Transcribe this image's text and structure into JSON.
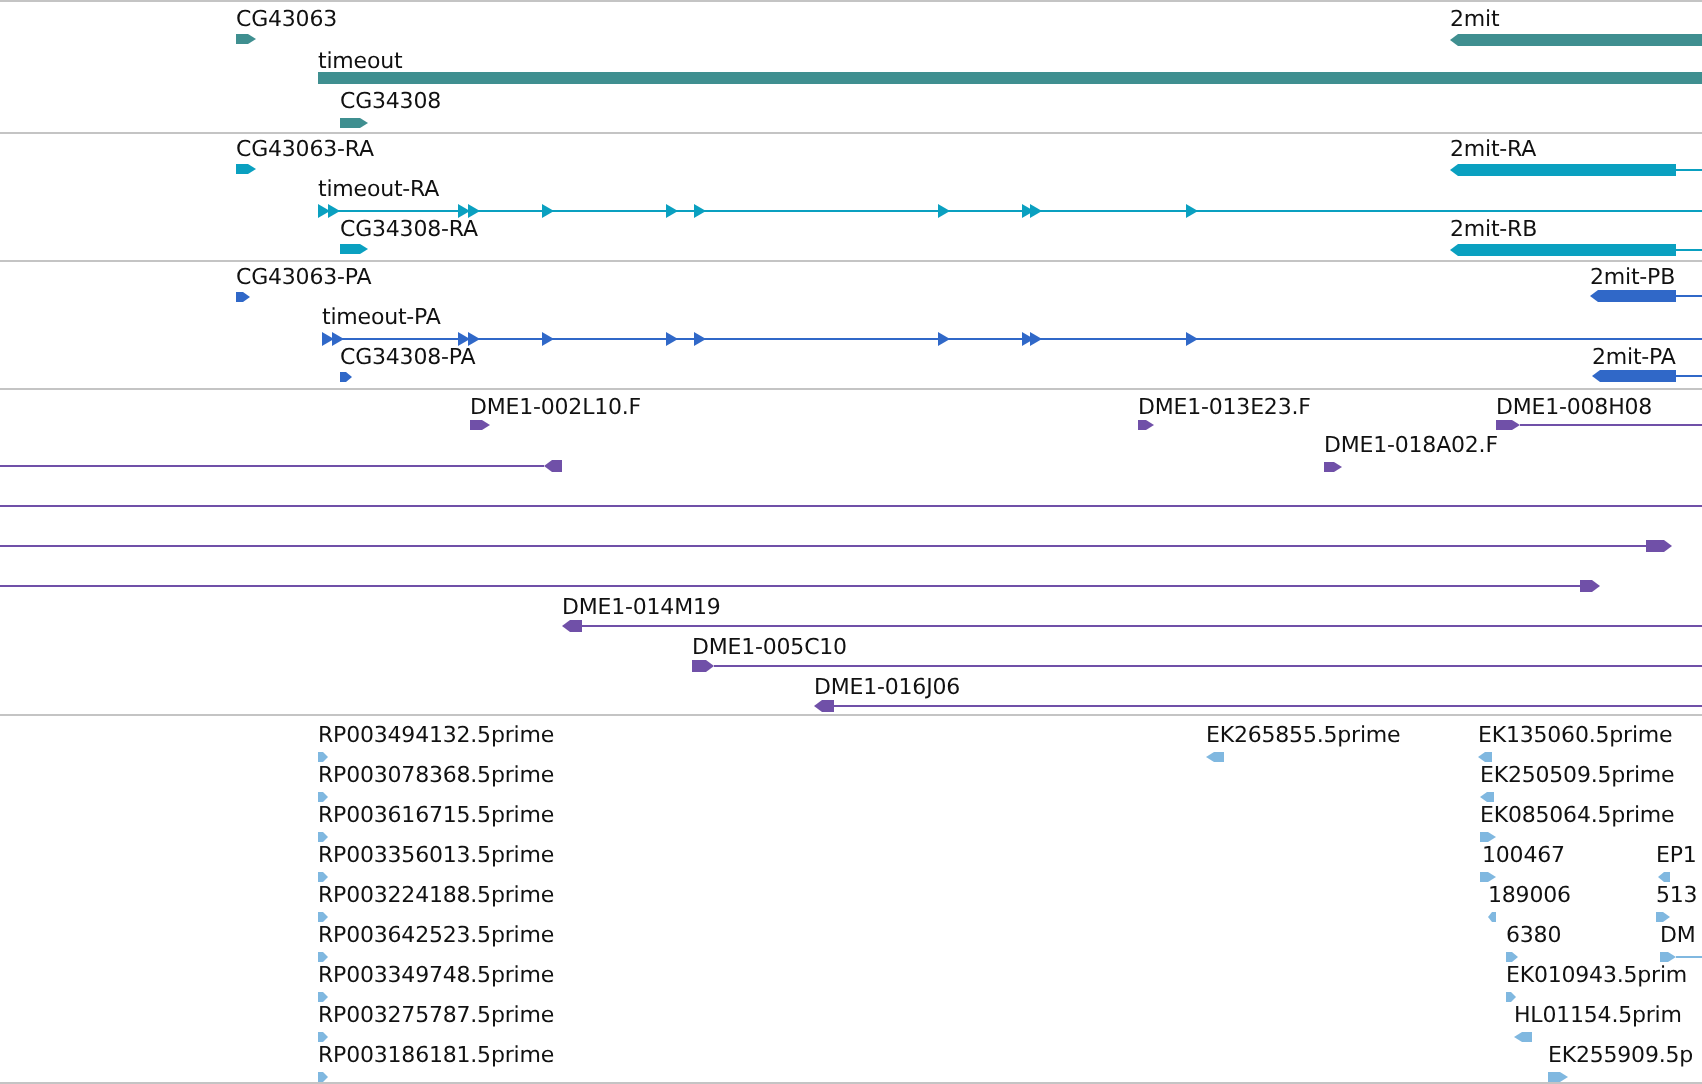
{
  "tracks": [
    {
      "color": "#3f8f90",
      "features": [
        {
          "label": "CG43063",
          "reverse": false
        },
        {
          "label": "timeout",
          "reverse": false
        },
        {
          "label": "CG34308",
          "reverse": false
        },
        {
          "label": "2mit",
          "reverse": true
        }
      ]
    },
    {
      "color": "#0aa0c0",
      "features": [
        {
          "label": "CG43063-RA",
          "reverse": false
        },
        {
          "label": "timeout-RA",
          "reverse": false
        },
        {
          "label": "CG34308-RA",
          "reverse": false
        },
        {
          "label": "2mit-RA",
          "reverse": true
        },
        {
          "label": "2mit-RB",
          "reverse": true
        }
      ]
    },
    {
      "color": "#3068c8",
      "features": [
        {
          "label": "CG43063-PA",
          "reverse": false
        },
        {
          "label": "timeout-PA",
          "reverse": false
        },
        {
          "label": "CG34308-PA",
          "reverse": false
        },
        {
          "label": "2mit-PB",
          "reverse": true
        },
        {
          "label": "2mit-PA",
          "reverse": true
        }
      ]
    },
    {
      "color": "#7050a8",
      "features": [
        {
          "label": "DME1-002L10.F",
          "reverse": false
        },
        {
          "label": "DME1-013E23.F",
          "reverse": false
        },
        {
          "label": "DME1-008H08",
          "reverse": false
        },
        {
          "reverse": true
        },
        {
          "label": "DME1-018A02.F",
          "reverse": false
        },
        {
          "reverse": false
        },
        {
          "reverse": false
        },
        {
          "reverse": false
        },
        {
          "label": "DME1-014M19",
          "reverse": true
        },
        {
          "label": "DME1-005C10",
          "reverse": false
        },
        {
          "label": "DME1-016J06",
          "reverse": true
        }
      ]
    },
    {
      "color": "#80b8e0",
      "features": [
        {
          "label": "RP003494132.5prime",
          "reverse": false
        },
        {
          "label": "EK265855.5prime",
          "reverse": true
        },
        {
          "label": "EK135060.5prime",
          "reverse": true
        },
        {
          "label": "RP003078368.5prime",
          "reverse": false
        },
        {
          "label": "EK250509.5prime",
          "reverse": true
        },
        {
          "label": "RP003616715.5prime",
          "reverse": false
        },
        {
          "label": "EK085064.5prime",
          "reverse": false
        },
        {
          "label": "RP003356013.5prime",
          "reverse": false
        },
        {
          "label": "100467",
          "reverse": false
        },
        {
          "label": "EP1",
          "reverse": true
        },
        {
          "label": "RP003224188.5prime",
          "reverse": false
        },
        {
          "label": "189006",
          "reverse": true
        },
        {
          "label": "513",
          "reverse": false
        },
        {
          "label": "RP003642523.5prime",
          "reverse": false
        },
        {
          "label": "6380",
          "reverse": false
        },
        {
          "label": "DM",
          "reverse": false
        },
        {
          "label": "RP003349748.5prime",
          "reverse": false
        },
        {
          "label": "EK010943.5prim",
          "reverse": false
        },
        {
          "label": "RP003275787.5prime",
          "reverse": false
        },
        {
          "label": "HL01154.5prim",
          "reverse": true
        },
        {
          "label": "RP003186181.5prime",
          "reverse": false
        },
        {
          "label": "EK255909.5p",
          "reverse": false
        }
      ]
    }
  ]
}
